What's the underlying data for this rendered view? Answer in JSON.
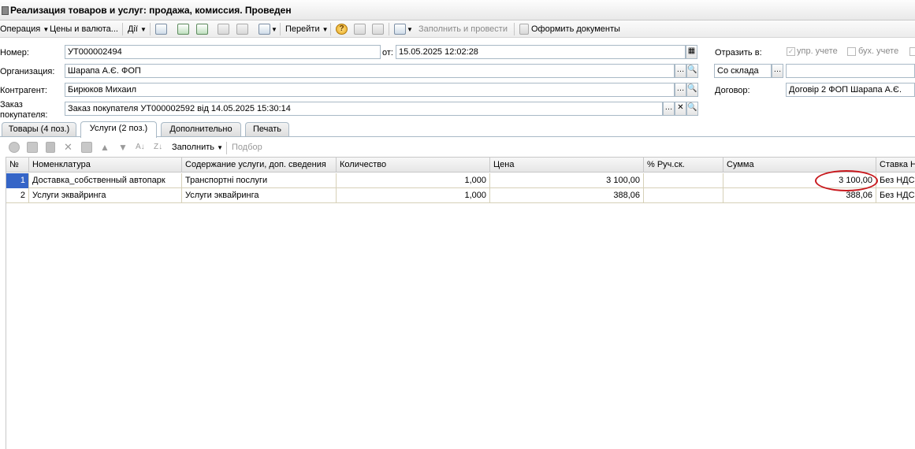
{
  "window": {
    "title": "Реализация товаров и услуг: продажа, комиссия. Проведен"
  },
  "toolbar": {
    "operation": "Операция",
    "prices": "Цены и валюта...",
    "actions": "Дії",
    "goto": "Перейти",
    "fill_and_post": "Заполнить и провести",
    "make_docs": "Оформить документы"
  },
  "form": {
    "number_label": "Номер:",
    "number_value": "УТ000002494",
    "from_label": "от:",
    "date_value": "15.05.2025 12:02:28",
    "reflect_label": "Отразить в:",
    "mgmt_label": "упр. учете",
    "acct_label": "бух. учете",
    "org_label": "Организация:",
    "org_value": "Шарапа А.Є. ФОП",
    "warehouse_value": "Со склада",
    "counterparty_label": "Контрагент:",
    "counterparty_value": "Бирюков Михаил",
    "contract_label": "Договор:",
    "contract_value": "Договір 2 ФОП Шарапа А.Є.",
    "order_label_1": "Заказ",
    "order_label_2": "покупателя:",
    "order_value": "Заказ покупателя УТ000002592 від 14.05.2025 15:30:14"
  },
  "tabs": [
    {
      "label": "Товары (4 поз.)"
    },
    {
      "label": "Услуги (2 поз.)"
    },
    {
      "label": "Дополнительно"
    },
    {
      "label": "Печать"
    }
  ],
  "grid_toolbar": {
    "fill": "Заполнить",
    "pick": "Подбор"
  },
  "table": {
    "columns": [
      "№",
      "Номенклатура",
      "Содержание услуги, доп. сведения",
      "Количество",
      "Цена",
      "% Руч.ск.",
      "Сумма",
      "Ставка НДС"
    ],
    "rows": [
      {
        "n": "1",
        "item": "Доставка_собственный автопарк",
        "content": "Транспортні послуги",
        "qty": "1,000",
        "price": "3 100,00",
        "disc": "",
        "sum": "3 100,00",
        "vat": "Без НДС"
      },
      {
        "n": "2",
        "item": "Услуги эквайринга",
        "content": "Услуги эквайринга",
        "qty": "1,000",
        "price": "388,06",
        "disc": "",
        "sum": "388,06",
        "vat": "Без НДС"
      }
    ]
  },
  "colors": {
    "highlight_oval": "#c8191e",
    "selected_row_number": "#3565c7"
  }
}
